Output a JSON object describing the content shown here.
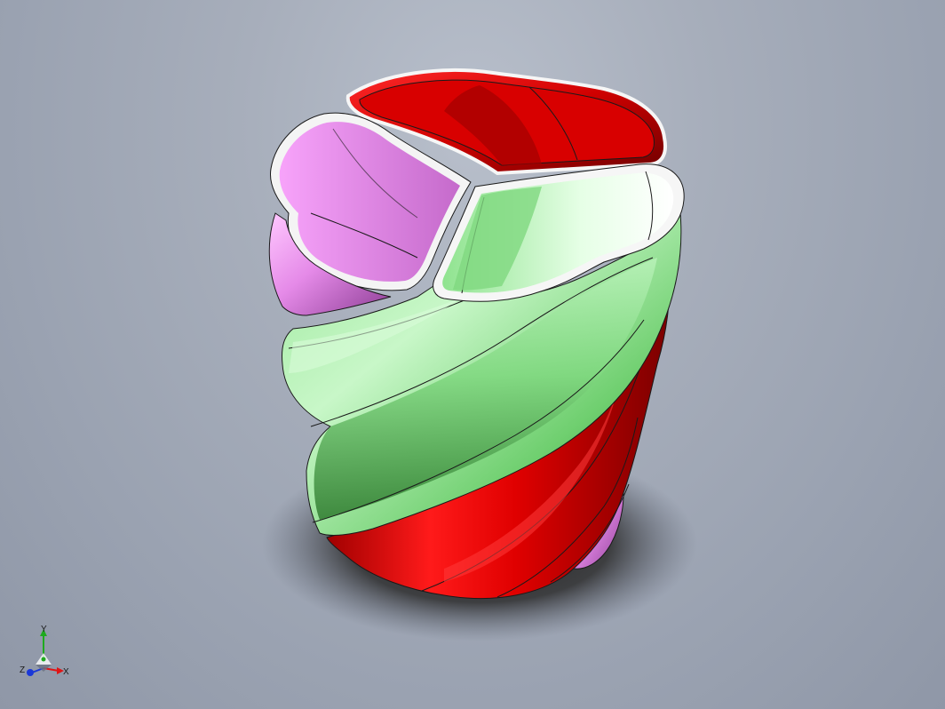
{
  "viewport": {
    "background_top": "#b8bfcb",
    "background_bottom": "#8f97a7"
  },
  "model": {
    "colors": {
      "red_body": "#e00000",
      "red_highlight": "#ff2a2a",
      "red_dark": "#7a0000",
      "green_body": "#8fe38f",
      "green_highlight": "#e6ffe6",
      "green_dark": "#2f6f2f",
      "pink_body": "#e58ae8",
      "pink_highlight": "#ffc8ff",
      "pink_dark": "#8d3e95",
      "edge": "#1a1a1a",
      "rim": "#f6f6f6",
      "shadow": "#2a2a2a"
    }
  },
  "triad": {
    "x_label": "X",
    "y_label": "Y",
    "z_label": "Z",
    "x_color": "#e01515",
    "y_color": "#1faa1f",
    "z_color": "#1a38d8"
  }
}
